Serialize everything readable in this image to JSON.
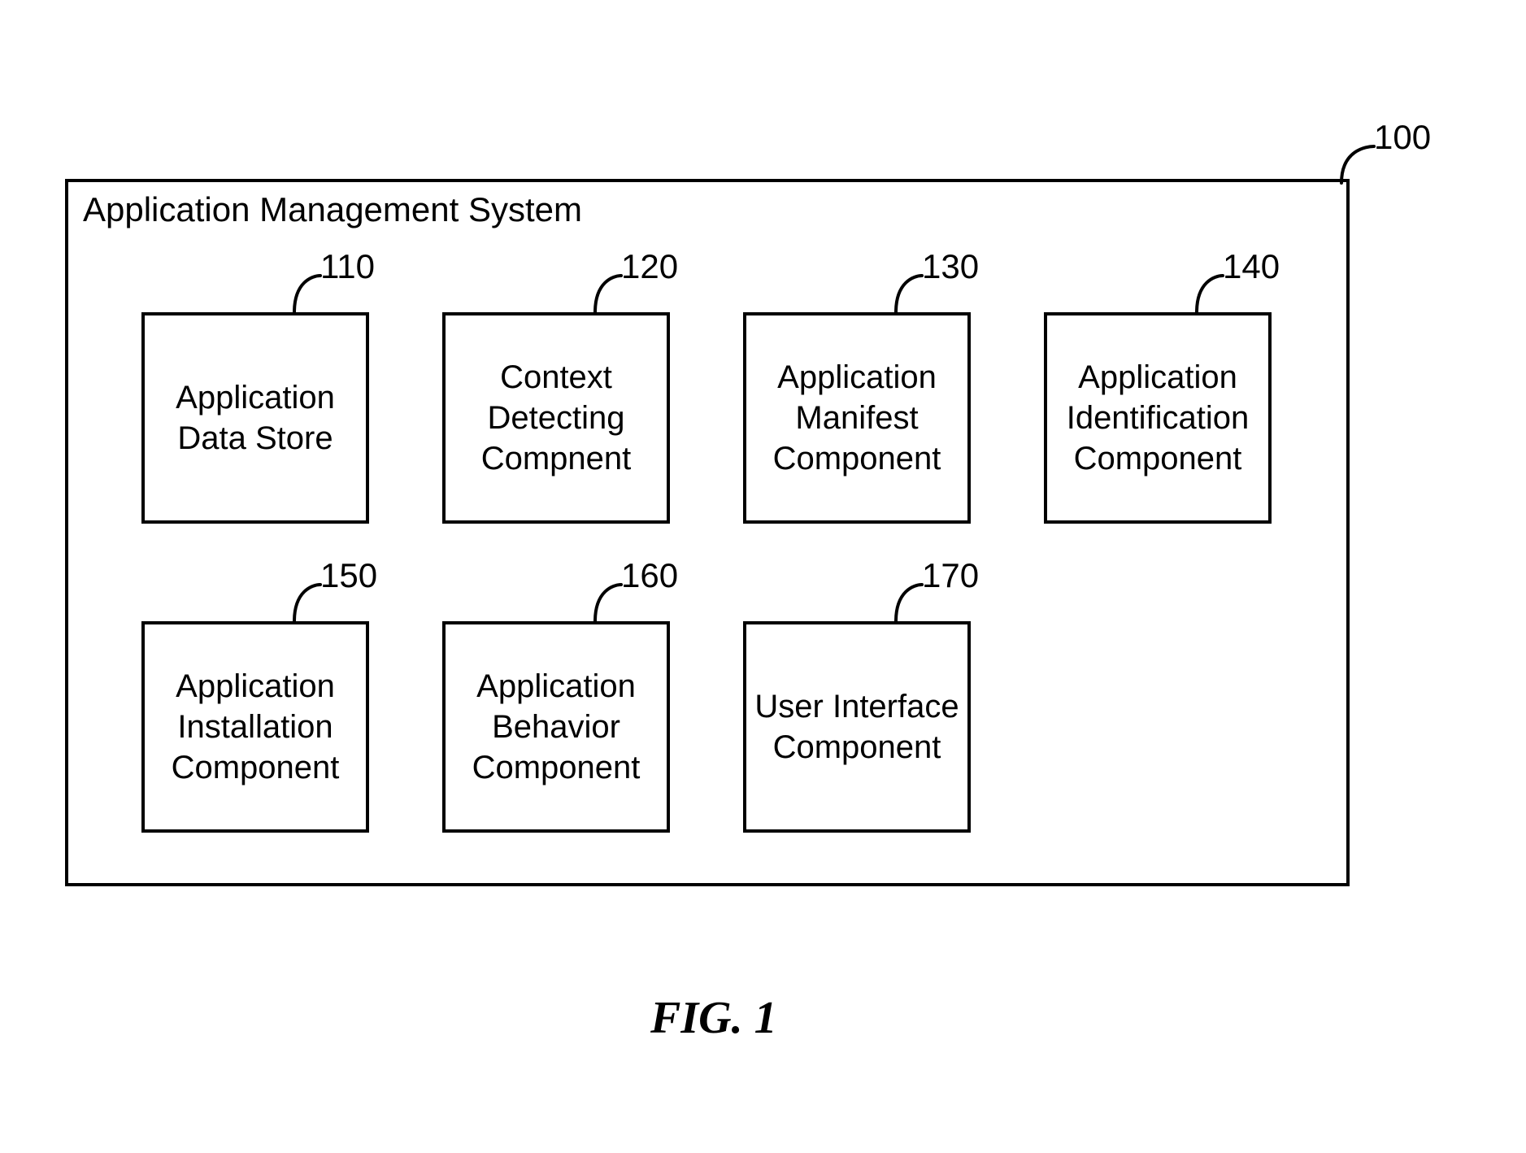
{
  "diagram": {
    "system_title": "Application Management System",
    "system_ref": "100",
    "caption": "FIG. 1",
    "components": [
      {
        "ref": "110",
        "label": "Application Data Store"
      },
      {
        "ref": "120",
        "label": "Context Detecting Compnent"
      },
      {
        "ref": "130",
        "label": "Application Manifest Component"
      },
      {
        "ref": "140",
        "label": "Application Identification Component"
      },
      {
        "ref": "150",
        "label": "Application Installation Component"
      },
      {
        "ref": "160",
        "label": "Application Behavior Component"
      },
      {
        "ref": "170",
        "label": "User Interface Component"
      }
    ]
  }
}
